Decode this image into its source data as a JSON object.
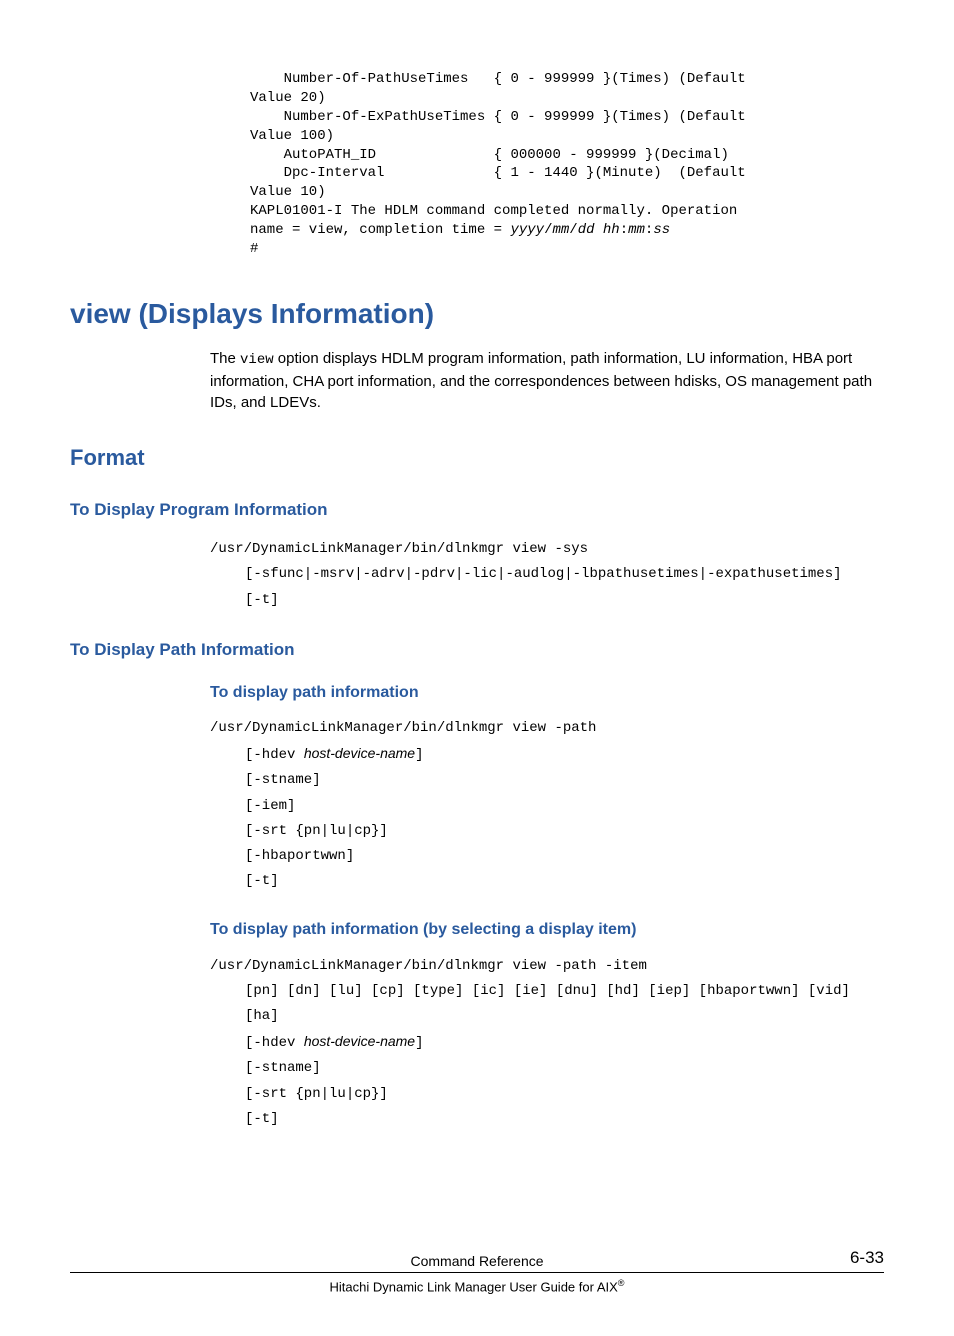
{
  "pre_top": {
    "line1": "    Number-Of-PathUseTimes   { 0 - 999999 }(Times) (Default",
    "line2": "Value 20)",
    "line3": "    Number-Of-ExPathUseTimes { 0 - 999999 }(Times) (Default",
    "line4": "Value 100)",
    "line5": "    AutoPATH_ID              { 000000 - 999999 }(Decimal)",
    "line6": "    Dpc-Interval             { 1 - 1440 }(Minute)  (Default",
    "line7": "Value 10)",
    "line8": "KAPL01001-I The HDLM command completed normally. Operation",
    "line9a": "name = view, completion time = ",
    "line9b": "yyyy",
    "line9c": "/",
    "line9d": "mm",
    "line9e": "/",
    "line9f": "dd hh",
    "line9g": ":",
    "line9h": "mm",
    "line9i": ":",
    "line9j": "ss",
    "line10": "#"
  },
  "h1": "view (Displays Information)",
  "intro_a": "The ",
  "intro_code": "view",
  "intro_b": " option displays HDLM program information, path information, LU information, HBA port information, CHA port information, and the correspondences between hdisks, OS management path IDs, and LDEVs.",
  "h2": "Format",
  "h3_program": "To Display Program Information",
  "prog": {
    "cmd": "/usr/DynamicLinkManager/bin/dlnkmgr view -sys",
    "opt1": "[-sfunc|-msrv|-adrv|-pdrv|-lic|-audlog|-lbpathusetimes|-expathusetimes]",
    "opt2": "[-t]"
  },
  "h3_path": "To Display Path Information",
  "h4_path_info": "To display path information",
  "path1": {
    "cmd": "/usr/DynamicLinkManager/bin/dlnkmgr view -path",
    "opt1a": "[-hdev ",
    "opt1b": "host-device-name",
    "opt1c": "]",
    "opt2": "[-stname]",
    "opt3": "[-iem]",
    "opt4": "[-srt {pn|lu|cp}]",
    "opt5": "[-hbaportwwn]",
    "opt6": "[-t]"
  },
  "h4_path_item": "To display path information (by selecting a display item)",
  "path2": {
    "cmd": "/usr/DynamicLinkManager/bin/dlnkmgr view -path -item",
    "opt1": "[pn] [dn] [lu] [cp] [type] [ic] [ie] [dnu] [hd] [iep] [hbaportwwn] [vid] [ha]",
    "opt2a": "[-hdev ",
    "opt2b": "host-device-name",
    "opt2c": "]",
    "opt3": "[-stname]",
    "opt4": "[-srt {pn|lu|cp}]",
    "opt5": "[-t]"
  },
  "footer": {
    "title": "Command Reference",
    "sub_a": "Hitachi Dynamic Link Manager User Guide for AIX",
    "pagenum": "6-33"
  }
}
